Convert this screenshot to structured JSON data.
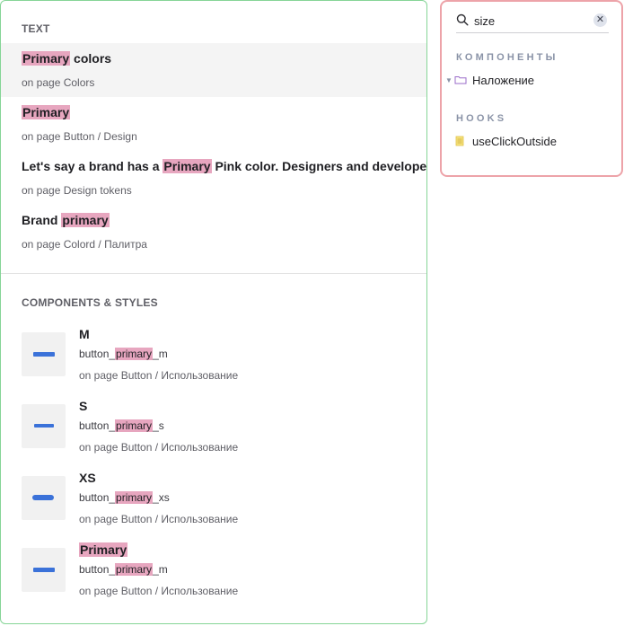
{
  "results": {
    "text_section_title": "TEXT",
    "text_items": [
      {
        "hl": "Primary",
        "rest": " colors",
        "pre": "",
        "page": "on page Colors"
      },
      {
        "hl": "Primary",
        "rest": "",
        "pre": "",
        "page": "on page Button / Design"
      },
      {
        "pre": "Let's say a brand has a ",
        "hl": "Primary",
        "rest": " Pink color. Designers and developers",
        "page": "on page Design tokens"
      },
      {
        "pre": "Brand ",
        "hl": "primary",
        "rest": "",
        "page": "on page Colord / Палитра"
      }
    ],
    "components_section_title": "COMPONENTS & STYLES",
    "components": [
      {
        "name": "M",
        "style_pre": "button_",
        "style_hl": "primary",
        "style_post": "_m",
        "page": "on page Button / Использование"
      },
      {
        "name": "S",
        "style_pre": "button_",
        "style_hl": "primary",
        "style_post": "_s",
        "page": "on page Button / Использование"
      },
      {
        "name": "XS",
        "style_pre": "button_",
        "style_hl": "primary",
        "style_post": "_xs",
        "page": "on page Button / Использование"
      },
      {
        "name": "Primary",
        "style_pre": "button_",
        "style_hl": "primary",
        "style_post": "_m",
        "page": "on page Button / Использование"
      }
    ]
  },
  "tree": {
    "search_value": "size",
    "group_components": "КОМПОНЕНТЫ",
    "item_folder": "Наложение",
    "group_hooks": "HOOKS",
    "item_hook": "useClickOutside"
  },
  "colors": {
    "highlight": "#e7a6bf",
    "results_border": "#86d597",
    "tree_border": "#eda3a9",
    "thumb_button": "#3b72d9"
  }
}
